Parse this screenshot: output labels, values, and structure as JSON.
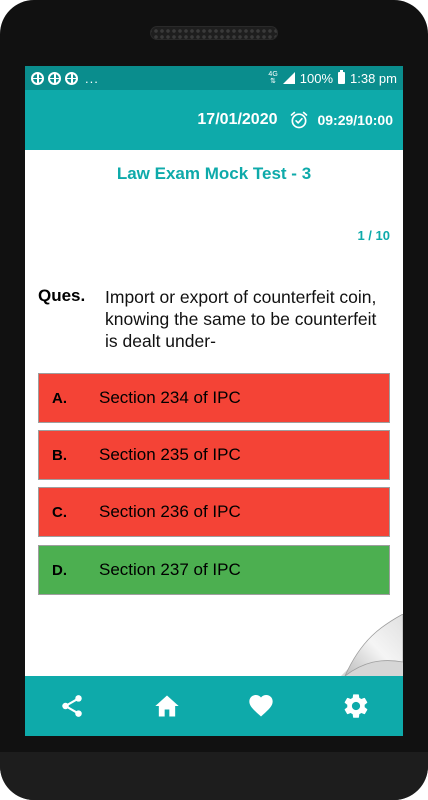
{
  "status_bar": {
    "notification_icons": [
      "notification-icon",
      "notification-icon",
      "notification-icon"
    ],
    "overflow": "...",
    "network_top": "4G",
    "network_bottom": "⇅",
    "battery_percent": "100%",
    "time": "1:38 pm"
  },
  "header": {
    "date": "17/01/2020",
    "timer_icon": "alarm-clock-icon",
    "timer": "09:29/10:00"
  },
  "quiz": {
    "title": "Law Exam Mock Test - 3",
    "progress": "1 / 10",
    "question_label": "Ques.",
    "question_text": "Import or export of counterfeit coin, knowing the same to be counterfeit is dealt under-"
  },
  "options": [
    {
      "letter": "A.",
      "text": "Section 234 of IPC",
      "state": "wrong"
    },
    {
      "letter": "B.",
      "text": "Section 235 of IPC",
      "state": "wrong"
    },
    {
      "letter": "C.",
      "text": "Section 236 of IPC",
      "state": "wrong"
    },
    {
      "letter": "D.",
      "text": "Section 237 of IPC",
      "state": "correct"
    }
  ],
  "bottom_nav": {
    "items": [
      "share-icon",
      "home-icon",
      "heart-icon",
      "settings-icon"
    ]
  },
  "colors": {
    "accent": "#0eaaaa",
    "status_bar": "#0a8d8d",
    "wrong": "#f44336",
    "correct": "#4caf50"
  }
}
